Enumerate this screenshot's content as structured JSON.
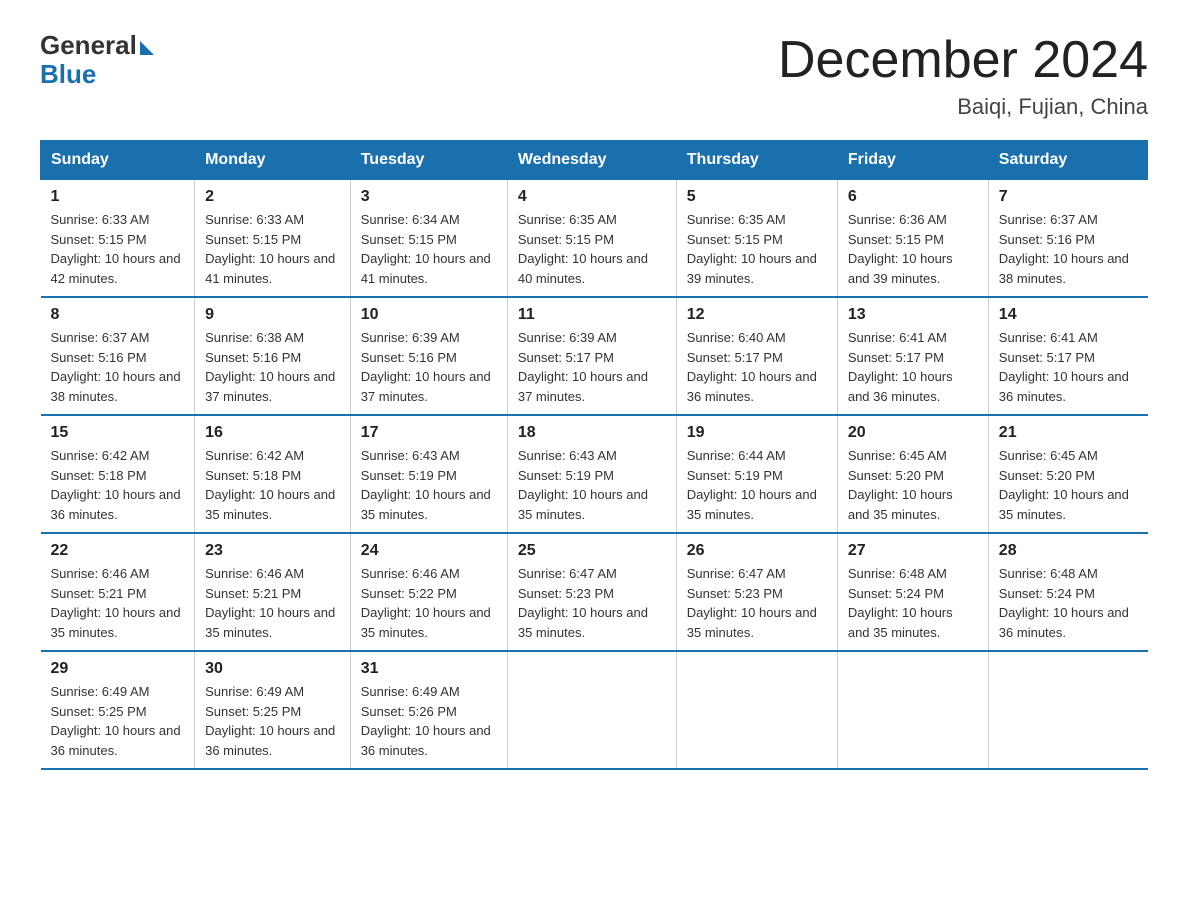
{
  "logo": {
    "general": "General",
    "blue": "Blue"
  },
  "header": {
    "title": "December 2024",
    "subtitle": "Baiqi, Fujian, China"
  },
  "days_of_week": [
    "Sunday",
    "Monday",
    "Tuesday",
    "Wednesday",
    "Thursday",
    "Friday",
    "Saturday"
  ],
  "weeks": [
    [
      {
        "day": "1",
        "sunrise": "6:33 AM",
        "sunset": "5:15 PM",
        "daylight": "10 hours and 42 minutes."
      },
      {
        "day": "2",
        "sunrise": "6:33 AM",
        "sunset": "5:15 PM",
        "daylight": "10 hours and 41 minutes."
      },
      {
        "day": "3",
        "sunrise": "6:34 AM",
        "sunset": "5:15 PM",
        "daylight": "10 hours and 41 minutes."
      },
      {
        "day": "4",
        "sunrise": "6:35 AM",
        "sunset": "5:15 PM",
        "daylight": "10 hours and 40 minutes."
      },
      {
        "day": "5",
        "sunrise": "6:35 AM",
        "sunset": "5:15 PM",
        "daylight": "10 hours and 39 minutes."
      },
      {
        "day": "6",
        "sunrise": "6:36 AM",
        "sunset": "5:15 PM",
        "daylight": "10 hours and 39 minutes."
      },
      {
        "day": "7",
        "sunrise": "6:37 AM",
        "sunset": "5:16 PM",
        "daylight": "10 hours and 38 minutes."
      }
    ],
    [
      {
        "day": "8",
        "sunrise": "6:37 AM",
        "sunset": "5:16 PM",
        "daylight": "10 hours and 38 minutes."
      },
      {
        "day": "9",
        "sunrise": "6:38 AM",
        "sunset": "5:16 PM",
        "daylight": "10 hours and 37 minutes."
      },
      {
        "day": "10",
        "sunrise": "6:39 AM",
        "sunset": "5:16 PM",
        "daylight": "10 hours and 37 minutes."
      },
      {
        "day": "11",
        "sunrise": "6:39 AM",
        "sunset": "5:17 PM",
        "daylight": "10 hours and 37 minutes."
      },
      {
        "day": "12",
        "sunrise": "6:40 AM",
        "sunset": "5:17 PM",
        "daylight": "10 hours and 36 minutes."
      },
      {
        "day": "13",
        "sunrise": "6:41 AM",
        "sunset": "5:17 PM",
        "daylight": "10 hours and 36 minutes."
      },
      {
        "day": "14",
        "sunrise": "6:41 AM",
        "sunset": "5:17 PM",
        "daylight": "10 hours and 36 minutes."
      }
    ],
    [
      {
        "day": "15",
        "sunrise": "6:42 AM",
        "sunset": "5:18 PM",
        "daylight": "10 hours and 36 minutes."
      },
      {
        "day": "16",
        "sunrise": "6:42 AM",
        "sunset": "5:18 PM",
        "daylight": "10 hours and 35 minutes."
      },
      {
        "day": "17",
        "sunrise": "6:43 AM",
        "sunset": "5:19 PM",
        "daylight": "10 hours and 35 minutes."
      },
      {
        "day": "18",
        "sunrise": "6:43 AM",
        "sunset": "5:19 PM",
        "daylight": "10 hours and 35 minutes."
      },
      {
        "day": "19",
        "sunrise": "6:44 AM",
        "sunset": "5:19 PM",
        "daylight": "10 hours and 35 minutes."
      },
      {
        "day": "20",
        "sunrise": "6:45 AM",
        "sunset": "5:20 PM",
        "daylight": "10 hours and 35 minutes."
      },
      {
        "day": "21",
        "sunrise": "6:45 AM",
        "sunset": "5:20 PM",
        "daylight": "10 hours and 35 minutes."
      }
    ],
    [
      {
        "day": "22",
        "sunrise": "6:46 AM",
        "sunset": "5:21 PM",
        "daylight": "10 hours and 35 minutes."
      },
      {
        "day": "23",
        "sunrise": "6:46 AM",
        "sunset": "5:21 PM",
        "daylight": "10 hours and 35 minutes."
      },
      {
        "day": "24",
        "sunrise": "6:46 AM",
        "sunset": "5:22 PM",
        "daylight": "10 hours and 35 minutes."
      },
      {
        "day": "25",
        "sunrise": "6:47 AM",
        "sunset": "5:23 PM",
        "daylight": "10 hours and 35 minutes."
      },
      {
        "day": "26",
        "sunrise": "6:47 AM",
        "sunset": "5:23 PM",
        "daylight": "10 hours and 35 minutes."
      },
      {
        "day": "27",
        "sunrise": "6:48 AM",
        "sunset": "5:24 PM",
        "daylight": "10 hours and 35 minutes."
      },
      {
        "day": "28",
        "sunrise": "6:48 AM",
        "sunset": "5:24 PM",
        "daylight": "10 hours and 36 minutes."
      }
    ],
    [
      {
        "day": "29",
        "sunrise": "6:49 AM",
        "sunset": "5:25 PM",
        "daylight": "10 hours and 36 minutes."
      },
      {
        "day": "30",
        "sunrise": "6:49 AM",
        "sunset": "5:25 PM",
        "daylight": "10 hours and 36 minutes."
      },
      {
        "day": "31",
        "sunrise": "6:49 AM",
        "sunset": "5:26 PM",
        "daylight": "10 hours and 36 minutes."
      },
      null,
      null,
      null,
      null
    ]
  ]
}
